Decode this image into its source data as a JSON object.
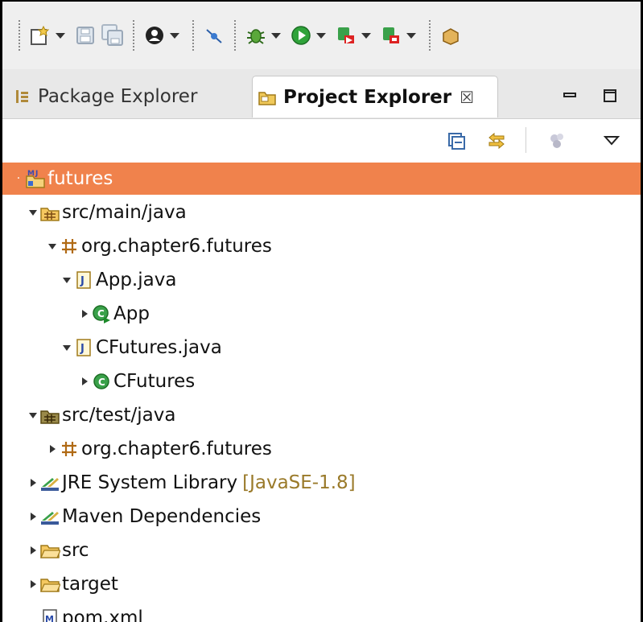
{
  "tabs": {
    "package_explorer": "Package Explorer",
    "project_explorer": "Project Explorer",
    "close_glyph": "☒"
  },
  "tree": [
    {
      "label": "futures",
      "expander": "none",
      "icon": "maven-project-icon"
    },
    {
      "label": "src/main/java",
      "expander": "expanded",
      "icon": "source-folder-icon"
    },
    {
      "label": "org.chapter6.futures",
      "expander": "expanded",
      "icon": "package-icon"
    },
    {
      "label": "App.java",
      "expander": "expanded",
      "icon": "java-file-icon"
    },
    {
      "label": "App",
      "expander": "collapsed",
      "icon": "runnable-class-icon"
    },
    {
      "label": "CFutures.java",
      "expander": "expanded",
      "icon": "java-file-icon"
    },
    {
      "label": "CFutures",
      "expander": "collapsed",
      "icon": "class-icon"
    },
    {
      "label": "src/test/java",
      "expander": "expanded",
      "icon": "source-folder-icon"
    },
    {
      "label": "org.chapter6.futures",
      "expander": "collapsed",
      "icon": "package-icon"
    },
    {
      "label": "JRE System Library",
      "decoration": "[JavaSE-1.8]",
      "expander": "collapsed",
      "icon": "library-icon"
    },
    {
      "label": "Maven Dependencies",
      "expander": "collapsed",
      "icon": "library-icon"
    },
    {
      "label": "src",
      "expander": "collapsed",
      "icon": "folder-icon"
    },
    {
      "label": "target",
      "expander": "collapsed",
      "icon": "folder-icon"
    },
    {
      "label": "pom.xml",
      "expander": "none",
      "icon": "maven-pom-icon"
    }
  ],
  "colors": {
    "selection": "#f0824c",
    "toolbar_bg": "#efefef",
    "decoration_text": "#9a7a2a"
  }
}
